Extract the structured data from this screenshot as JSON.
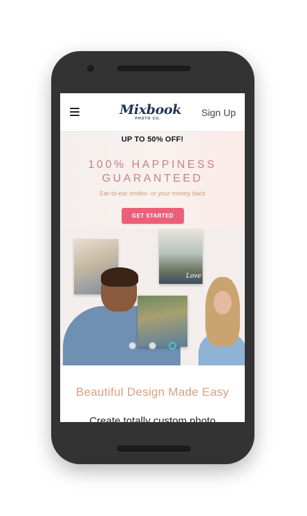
{
  "nav": {
    "logo_main": "Mixbook",
    "logo_sub": "PHOTO CO.",
    "signup": "Sign Up"
  },
  "hero": {
    "promo": "UP TO 50% OFF!",
    "headline_line1": "100% HAPPINESS",
    "headline_line2": "GUARANTEED",
    "subline": "Ear-to-ear smiles- or your money back",
    "cta": "GET STARTED",
    "photo_caption": "Love",
    "carousel_active_index": 2,
    "carousel_count": 3
  },
  "section": {
    "title": "Beautiful Design Made Easy",
    "body_partial": "Create totally custom photo"
  },
  "colors": {
    "phone_body": "#333333",
    "cta_bg": "#ec5f79",
    "headline": "#c97f86",
    "logo": "#1f3556",
    "carousel_active": "#4ec3c8"
  },
  "icons": [
    "hamburger-menu-icon"
  ]
}
